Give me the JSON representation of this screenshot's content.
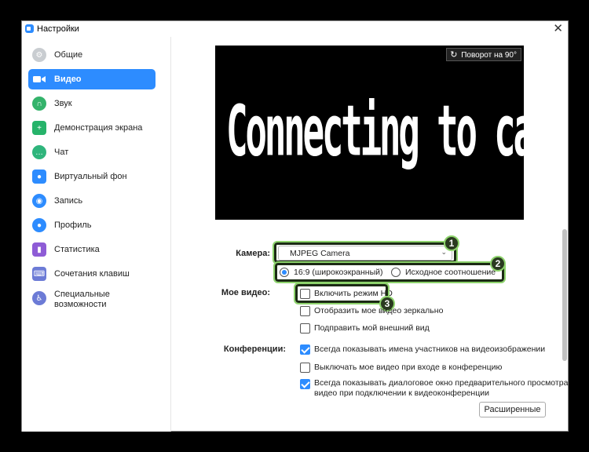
{
  "window": {
    "title": "Настройки",
    "close_glyph": "✕"
  },
  "sidebar": {
    "items": [
      {
        "label": "Общие",
        "icon": "gear-icon",
        "color": "#9aa0a6"
      },
      {
        "label": "Видео",
        "icon": "video-icon",
        "color": "#2d8cff",
        "active": true
      },
      {
        "label": "Звук",
        "icon": "headphones-icon",
        "color": "#34b36b"
      },
      {
        "label": "Демонстрация экрана",
        "icon": "share-screen-icon",
        "color": "#26b36a"
      },
      {
        "label": "Чат",
        "icon": "chat-icon",
        "color": "#2fb57c"
      },
      {
        "label": "Виртуальный фон",
        "icon": "virtual-background-icon",
        "color": "#2d8cff"
      },
      {
        "label": "Запись",
        "icon": "record-icon",
        "color": "#2d8cff"
      },
      {
        "label": "Профиль",
        "icon": "profile-icon",
        "color": "#2d8cff"
      },
      {
        "label": "Статистика",
        "icon": "statistics-icon",
        "color": "#8e5cd6"
      },
      {
        "label": "Сочетания клавиш",
        "icon": "keyboard-icon",
        "color": "#6c7bd6"
      },
      {
        "label": "Специальные возможности",
        "icon": "accessibility-icon",
        "color": "#6c7bd6"
      }
    ]
  },
  "preview": {
    "connecting_text": "Connecting to camera...",
    "rotate_label": "Поворот на 90°"
  },
  "camera": {
    "label": "Камера:",
    "selected": "MJPEG Camera",
    "ratio_169": "16:9 (широкоэкранный)",
    "ratio_original": "Исходное соотношение"
  },
  "my_video": {
    "label": "Мое видео:",
    "hd": "Включить режим HD",
    "mirror": "Отобразить мое видео зеркально",
    "touch_up": "Подправить мой внешний вид"
  },
  "meetings": {
    "label": "Конференции:",
    "show_names": "Всегда показывать имена участников на видеоизображении",
    "turn_off_video": "Выключать мое видео при входе в конференцию",
    "preview_dialog_line1": "Всегда показывать диалоговое окно предварительного просмотра",
    "preview_dialog_line2": "видео при подключении к видеоконференции"
  },
  "advanced_button": "Расширенные",
  "badges": [
    "1",
    "2",
    "3"
  ],
  "colors": {
    "accent": "#2d8cff",
    "highlight": "#8dd36c"
  }
}
